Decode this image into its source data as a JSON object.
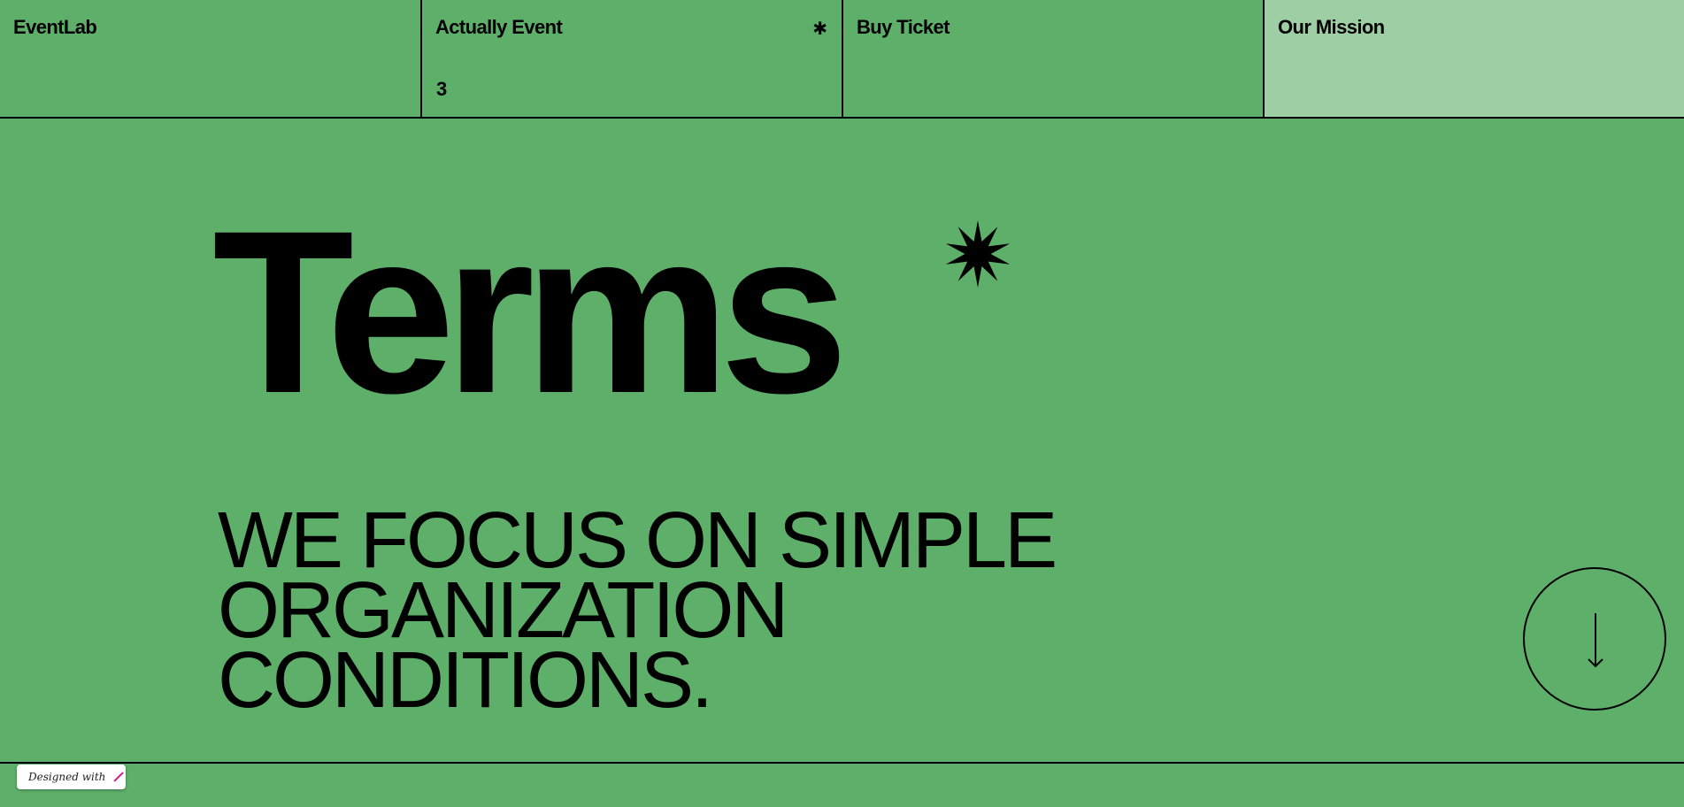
{
  "nav": {
    "brand": "EventLab",
    "event_label": "Actually Event",
    "event_star": "✱",
    "event_count": "3",
    "ticket_label": "Buy Ticket",
    "mission_label": "Our Mission"
  },
  "hero": {
    "title": "Terms",
    "tagline_lines": [
      "We focus on simple",
      "organization",
      "conditions."
    ]
  },
  "badge": {
    "text": "Designed with"
  },
  "colors": {
    "background": "#5eaf69",
    "active_tab": "#9ecea4",
    "ink": "#000000",
    "badge_accent": "#d81b8c"
  },
  "icons": {
    "burst": "star-burst-icon",
    "scroll": "arrow-down-icon"
  }
}
